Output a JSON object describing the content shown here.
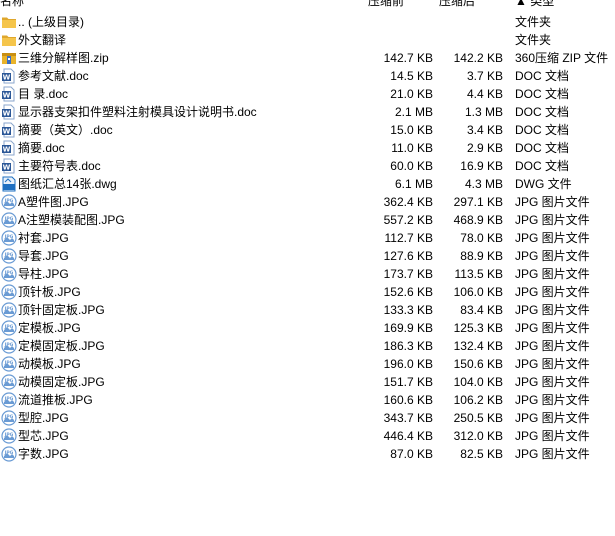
{
  "header": {
    "name": "名称",
    "original_size": "压缩前",
    "compressed_size": "压缩后",
    "type": "类型",
    "sort_indicator": "▲"
  },
  "files": [
    {
      "icon": "folder-up-icon",
      "name": ".. (上级目录)",
      "orig": "",
      "comp": "",
      "type": "文件夹"
    },
    {
      "icon": "folder-icon",
      "name": "外文翻译",
      "orig": "",
      "comp": "",
      "type": "文件夹"
    },
    {
      "icon": "zip-archive-icon",
      "name": "三维分解样图.zip",
      "orig": "142.7 KB",
      "comp": "142.2 KB",
      "type": "360压缩 ZIP 文件"
    },
    {
      "icon": "word-doc-icon",
      "name": "参考文献.doc",
      "orig": "14.5 KB",
      "comp": "3.7 KB",
      "type": "DOC 文档"
    },
    {
      "icon": "word-doc-icon",
      "name": "目  录.doc",
      "orig": "21.0 KB",
      "comp": "4.4 KB",
      "type": "DOC 文档"
    },
    {
      "icon": "word-doc-icon",
      "name": "显示器支架扣件塑料注射模具设计说明书.doc",
      "orig": "2.1 MB",
      "comp": "1.3 MB",
      "type": "DOC 文档"
    },
    {
      "icon": "word-doc-icon",
      "name": "摘要（英文）.doc",
      "orig": "15.0 KB",
      "comp": "3.4 KB",
      "type": "DOC 文档"
    },
    {
      "icon": "word-doc-icon",
      "name": "摘要.doc",
      "orig": "11.0 KB",
      "comp": "2.9 KB",
      "type": "DOC 文档"
    },
    {
      "icon": "word-doc-icon",
      "name": "主要符号表.doc",
      "orig": "60.0 KB",
      "comp": "16.9 KB",
      "type": "DOC 文档"
    },
    {
      "icon": "dwg-file-icon",
      "name": "图纸汇总14张.dwg",
      "orig": "6.1 MB",
      "comp": "4.3 MB",
      "type": "DWG 文件"
    },
    {
      "icon": "jpg-image-icon",
      "name": "A塑件图.JPG",
      "orig": "362.4 KB",
      "comp": "297.1 KB",
      "type": "JPG 图片文件"
    },
    {
      "icon": "jpg-image-icon",
      "name": "A注塑模装配图.JPG",
      "orig": "557.2 KB",
      "comp": "468.9 KB",
      "type": "JPG 图片文件"
    },
    {
      "icon": "jpg-image-icon",
      "name": "衬套.JPG",
      "orig": "112.7 KB",
      "comp": "78.0 KB",
      "type": "JPG 图片文件"
    },
    {
      "icon": "jpg-image-icon",
      "name": "导套.JPG",
      "orig": "127.6 KB",
      "comp": "88.9 KB",
      "type": "JPG 图片文件"
    },
    {
      "icon": "jpg-image-icon",
      "name": "导柱.JPG",
      "orig": "173.7 KB",
      "comp": "113.5 KB",
      "type": "JPG 图片文件"
    },
    {
      "icon": "jpg-image-icon",
      "name": "顶针板.JPG",
      "orig": "152.6 KB",
      "comp": "106.0 KB",
      "type": "JPG 图片文件"
    },
    {
      "icon": "jpg-image-icon",
      "name": "顶针固定板.JPG",
      "orig": "133.3 KB",
      "comp": "83.4 KB",
      "type": "JPG 图片文件"
    },
    {
      "icon": "jpg-image-icon",
      "name": "定模板.JPG",
      "orig": "169.9 KB",
      "comp": "125.3 KB",
      "type": "JPG 图片文件"
    },
    {
      "icon": "jpg-image-icon",
      "name": "定模固定板.JPG",
      "orig": "186.3 KB",
      "comp": "132.4 KB",
      "type": "JPG 图片文件"
    },
    {
      "icon": "jpg-image-icon",
      "name": "动模板.JPG",
      "orig": "196.0 KB",
      "comp": "150.6 KB",
      "type": "JPG 图片文件"
    },
    {
      "icon": "jpg-image-icon",
      "name": "动模固定板.JPG",
      "orig": "151.7 KB",
      "comp": "104.0 KB",
      "type": "JPG 图片文件"
    },
    {
      "icon": "jpg-image-icon",
      "name": "流道推板.JPG",
      "orig": "160.6 KB",
      "comp": "106.2 KB",
      "type": "JPG 图片文件"
    },
    {
      "icon": "jpg-image-icon",
      "name": "型腔.JPG",
      "orig": "343.7 KB",
      "comp": "250.5 KB",
      "type": "JPG 图片文件"
    },
    {
      "icon": "jpg-image-icon",
      "name": "型芯.JPG",
      "orig": "446.4 KB",
      "comp": "312.0 KB",
      "type": "JPG 图片文件"
    },
    {
      "icon": "jpg-image-icon",
      "name": "字数.JPG",
      "orig": "87.0 KB",
      "comp": "82.5 KB",
      "type": "JPG 图片文件"
    }
  ],
  "colors": {
    "folder": "#f5c54b",
    "folder_dark": "#dfa72d",
    "word": "#2b5797",
    "jpg": "#6a9bd4",
    "zip": "#e9b32a",
    "dwg": "#1e6fc1"
  }
}
